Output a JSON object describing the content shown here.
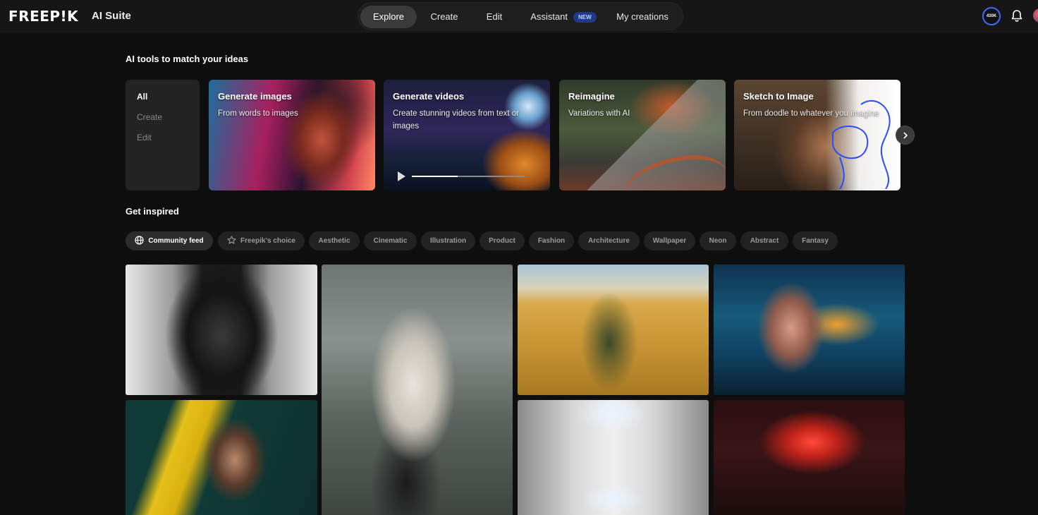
{
  "header": {
    "logo": "FREEP!K",
    "suite": "AI Suite",
    "nav": [
      {
        "label": "Explore"
      },
      {
        "label": "Create"
      },
      {
        "label": "Edit"
      },
      {
        "label": "Assistant",
        "badge": "NEW"
      },
      {
        "label": "My creations"
      }
    ],
    "credits": "430K"
  },
  "tools": {
    "title": "AI tools to match your ideas",
    "menu": [
      "All",
      "Create",
      "Edit"
    ],
    "cards": [
      {
        "title": "Generate images",
        "subtitle": "From words to images"
      },
      {
        "title": "Generate videos",
        "subtitle": "Create stunning videos from text or images"
      },
      {
        "title": "Reimagine",
        "subtitle": "Variations with AI"
      },
      {
        "title": "Sketch to Image",
        "subtitle": "From doodle to whatever you imagine"
      }
    ]
  },
  "inspired": {
    "title": "Get inspired",
    "chips": [
      "Community feed",
      "Freepik's choice",
      "Aesthetic",
      "Cinematic",
      "Illustration",
      "Product",
      "Fashion",
      "Architecture",
      "Wallpaper",
      "Neon",
      "Abstract",
      "Fantasy"
    ]
  },
  "colors": {
    "background": "#0e0e0e",
    "accent": "#3b6cff",
    "badge": "#1e3a8a"
  }
}
